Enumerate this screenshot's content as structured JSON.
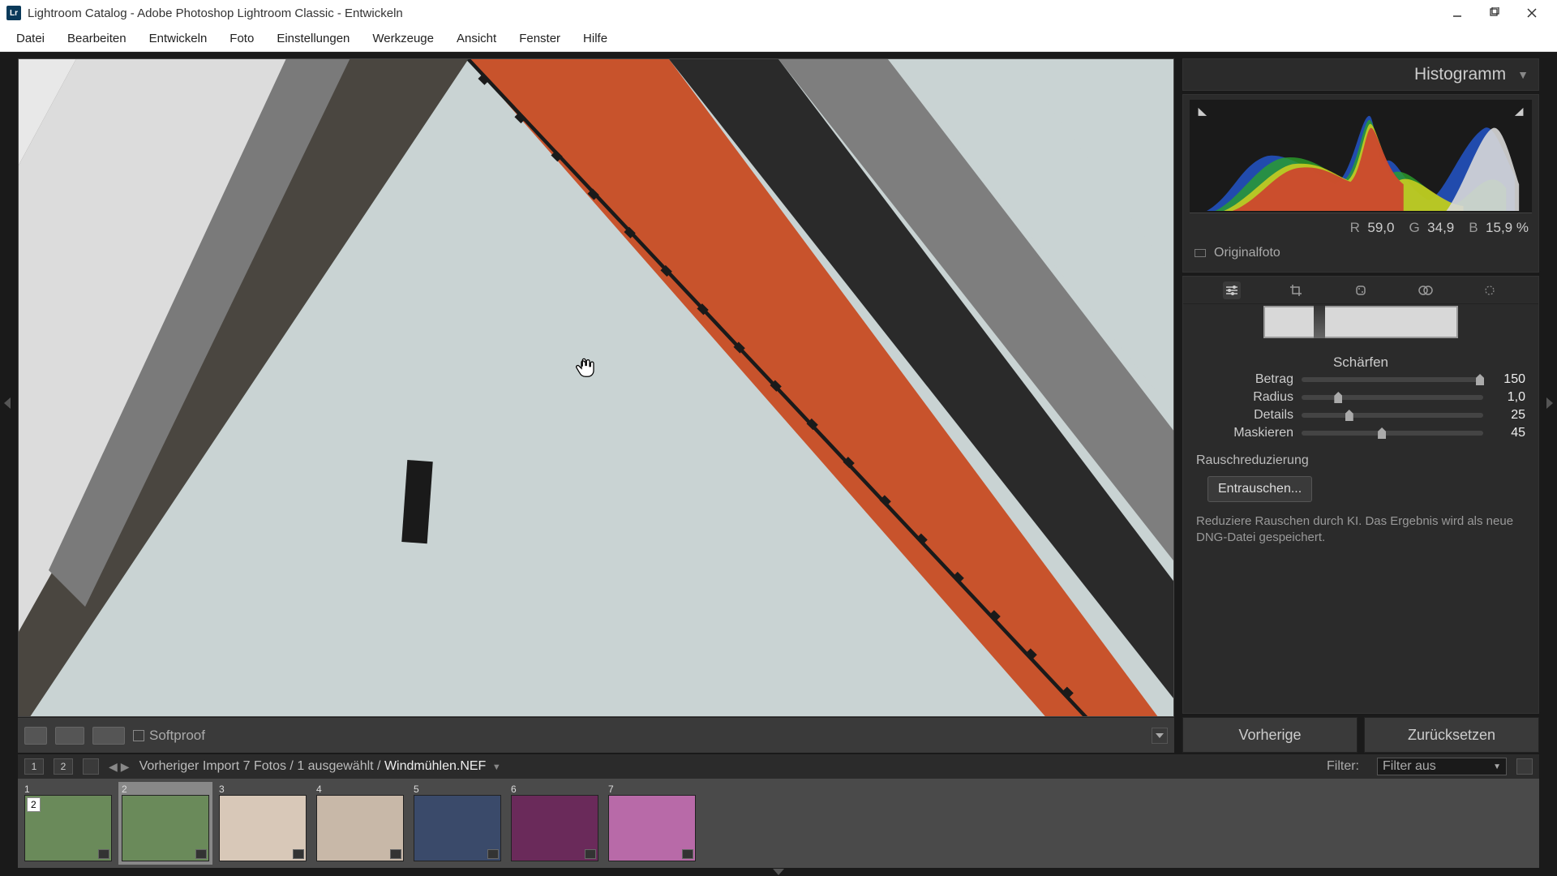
{
  "titlebar": {
    "app_icon_text": "Lr",
    "title": "Lightroom Catalog - Adobe Photoshop Lightroom Classic - Entwickeln"
  },
  "menu": [
    "Datei",
    "Bearbeiten",
    "Entwickeln",
    "Foto",
    "Einstellungen",
    "Werkzeuge",
    "Ansicht",
    "Fenster",
    "Hilfe"
  ],
  "toolbar": {
    "softproof_label": "Softproof"
  },
  "panels": {
    "histogram_title": "Histogramm",
    "rgb": {
      "r_label": "R",
      "r_value": "59,0",
      "g_label": "G",
      "g_value": "34,9",
      "b_label": "B",
      "b_value": "15,9",
      "pct": "%"
    },
    "original_label": "Originalfoto",
    "sharpen": {
      "title": "Schärfen",
      "rows": [
        {
          "label": "Betrag",
          "value": "150",
          "pos": 96
        },
        {
          "label": "Radius",
          "value": "1,0",
          "pos": 18
        },
        {
          "label": "Details",
          "value": "25",
          "pos": 24
        },
        {
          "label": "Maskieren",
          "value": "45",
          "pos": 42
        }
      ]
    },
    "noise": {
      "title": "Rauschreduzierung",
      "denoise_label": "Entrauschen...",
      "desc": "Reduziere Rauschen durch KI. Das Ergebnis wird als neue DNG-Datei gespeichert."
    },
    "prev_btn": "Vorherige",
    "reset_btn": "Zurücksetzen"
  },
  "filmstrip": {
    "screen_1": "1",
    "screen_2": "2",
    "crumbs": "Vorheriger Import   7 Fotos / 1 ausgewählt / ",
    "filename": "Windmühlen.NEF",
    "filter_label": "Filter:",
    "filter_value": "Filter aus",
    "thumbs": [
      {
        "num": "1",
        "count": "2"
      },
      {
        "num": "2",
        "selected": true
      },
      {
        "num": "3"
      },
      {
        "num": "4"
      },
      {
        "num": "5"
      },
      {
        "num": "6"
      },
      {
        "num": "7"
      }
    ]
  }
}
